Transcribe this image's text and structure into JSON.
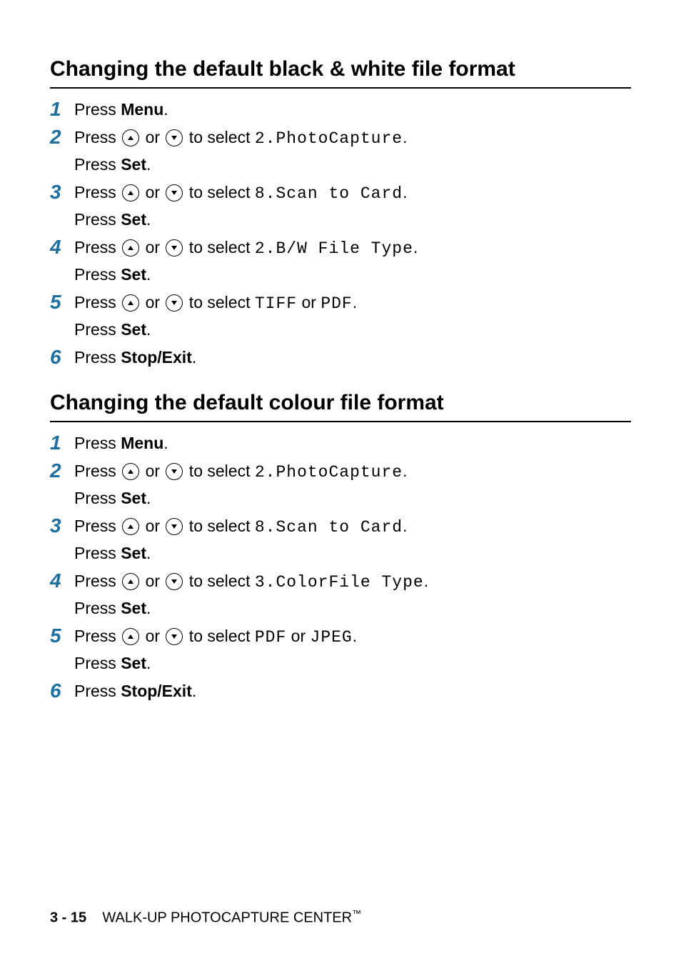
{
  "section1": {
    "heading": "Changing the default black & white file format",
    "steps": {
      "s1": {
        "press": "Press ",
        "menu": "Menu",
        "dot": "."
      },
      "s2": {
        "press": "Press ",
        "or": " or ",
        "select_text": " to select ",
        "mono": "2.PhotoCapture",
        "enddot": ".",
        "press_set_label": "Press ",
        "set": "Set",
        "setdot": "."
      },
      "s3": {
        "press": "Press ",
        "or": " or ",
        "select_text": " to select ",
        "mono": "8.Scan to Card",
        "enddot": ".",
        "press_set_label": "Press ",
        "set": "Set",
        "setdot": "."
      },
      "s4": {
        "press": "Press ",
        "or": " or ",
        "select_text": " to select ",
        "mono": "2.B/W File Type",
        "enddot": ".",
        "press_set_label": "Press ",
        "set": "Set",
        "setdot": "."
      },
      "s5": {
        "press": "Press ",
        "or": " or ",
        "select_text": " to select ",
        "mono1": "TIFF",
        "or2": " or ",
        "mono2": "PDF",
        "enddot": ".",
        "press_set_label": "Press ",
        "set": "Set",
        "setdot": "."
      },
      "s6": {
        "press": "Press ",
        "stopexit": "Stop/Exit",
        "dot": "."
      }
    }
  },
  "section2": {
    "heading": "Changing the default colour file format",
    "steps": {
      "s1": {
        "press": "Press ",
        "menu": "Menu",
        "dot": "."
      },
      "s2": {
        "press": "Press ",
        "or": " or ",
        "select_text": " to select ",
        "mono": "2.PhotoCapture",
        "enddot": ".",
        "press_set_label": "Press ",
        "set": "Set",
        "setdot": "."
      },
      "s3": {
        "press": "Press ",
        "or": " or ",
        "select_text": " to select ",
        "mono": "8.Scan to Card",
        "enddot": ".",
        "press_set_label": "Press ",
        "set": "Set",
        "setdot": "."
      },
      "s4": {
        "press": "Press ",
        "or": " or ",
        "select_text": " to select ",
        "mono": "3.ColorFile Type",
        "enddot": ".",
        "press_set_label": "Press ",
        "set": "Set",
        "setdot": "."
      },
      "s5": {
        "press": "Press ",
        "or": " or ",
        "select_text": " to select ",
        "mono1": "PDF",
        "or2": " or ",
        "mono2": "JPEG",
        "enddot": ".",
        "press_set_label": "Press ",
        "set": "Set",
        "setdot": "."
      },
      "s6": {
        "press": "Press ",
        "stopexit": "Stop/Exit",
        "dot": "."
      }
    }
  },
  "footer": {
    "page": "3 - 15",
    "title": "WALK-UP PHOTOCAPTURE CENTER",
    "tm": "™"
  },
  "nums": {
    "n1": "1",
    "n2": "2",
    "n3": "3",
    "n4": "4",
    "n5": "5",
    "n6": "6"
  }
}
